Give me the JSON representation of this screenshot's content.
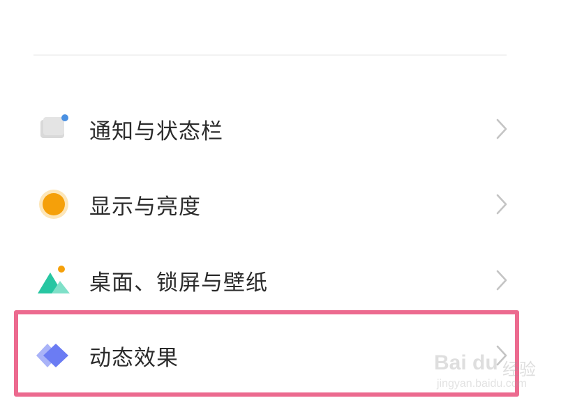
{
  "settings_list": {
    "items": [
      {
        "label": "通知与状态栏",
        "icon": "notification-icon",
        "has_chevron": true
      },
      {
        "label": "显示与亮度",
        "icon": "brightness-icon",
        "has_chevron": true
      },
      {
        "label": "桌面、锁屏与壁纸",
        "icon": "wallpaper-icon",
        "has_chevron": true
      },
      {
        "label": "动态效果",
        "icon": "animation-icon",
        "has_chevron": true,
        "highlighted": true
      }
    ]
  },
  "highlight": {
    "color": "#ec6a8f",
    "target": "动态效果"
  },
  "watermark": {
    "brand": "Bai du",
    "service": "经验",
    "url": "jingyan.baidu.com"
  },
  "colors": {
    "label_text": "#2b2b2b",
    "chevron": "#c4c4c4",
    "notification_dot": "#4a90e2",
    "brightness": "#f5a00a",
    "wallpaper": "#27c6a2",
    "animation": "#6b7cf3"
  }
}
